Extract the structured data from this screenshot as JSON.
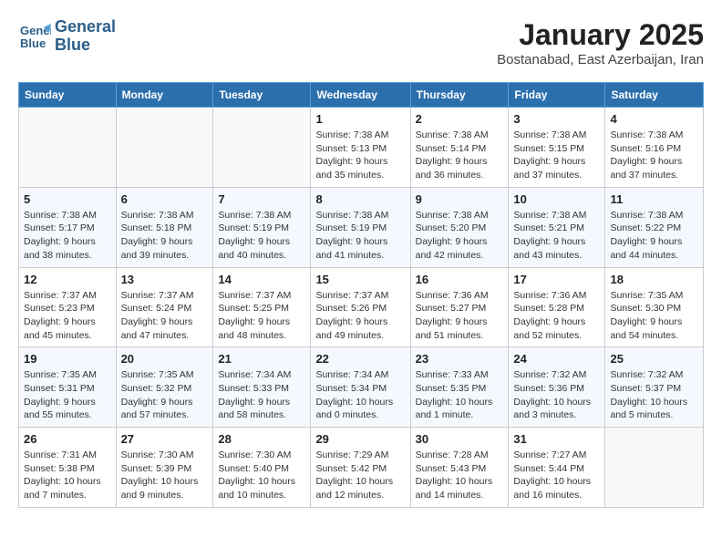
{
  "header": {
    "logo_line1": "General",
    "logo_line2": "Blue",
    "month": "January 2025",
    "location": "Bostanabad, East Azerbaijan, Iran"
  },
  "weekdays": [
    "Sunday",
    "Monday",
    "Tuesday",
    "Wednesday",
    "Thursday",
    "Friday",
    "Saturday"
  ],
  "weeks": [
    [
      {
        "day": "",
        "info": ""
      },
      {
        "day": "",
        "info": ""
      },
      {
        "day": "",
        "info": ""
      },
      {
        "day": "1",
        "info": "Sunrise: 7:38 AM\nSunset: 5:13 PM\nDaylight: 9 hours\nand 35 minutes."
      },
      {
        "day": "2",
        "info": "Sunrise: 7:38 AM\nSunset: 5:14 PM\nDaylight: 9 hours\nand 36 minutes."
      },
      {
        "day": "3",
        "info": "Sunrise: 7:38 AM\nSunset: 5:15 PM\nDaylight: 9 hours\nand 37 minutes."
      },
      {
        "day": "4",
        "info": "Sunrise: 7:38 AM\nSunset: 5:16 PM\nDaylight: 9 hours\nand 37 minutes."
      }
    ],
    [
      {
        "day": "5",
        "info": "Sunrise: 7:38 AM\nSunset: 5:17 PM\nDaylight: 9 hours\nand 38 minutes."
      },
      {
        "day": "6",
        "info": "Sunrise: 7:38 AM\nSunset: 5:18 PM\nDaylight: 9 hours\nand 39 minutes."
      },
      {
        "day": "7",
        "info": "Sunrise: 7:38 AM\nSunset: 5:19 PM\nDaylight: 9 hours\nand 40 minutes."
      },
      {
        "day": "8",
        "info": "Sunrise: 7:38 AM\nSunset: 5:19 PM\nDaylight: 9 hours\nand 41 minutes."
      },
      {
        "day": "9",
        "info": "Sunrise: 7:38 AM\nSunset: 5:20 PM\nDaylight: 9 hours\nand 42 minutes."
      },
      {
        "day": "10",
        "info": "Sunrise: 7:38 AM\nSunset: 5:21 PM\nDaylight: 9 hours\nand 43 minutes."
      },
      {
        "day": "11",
        "info": "Sunrise: 7:38 AM\nSunset: 5:22 PM\nDaylight: 9 hours\nand 44 minutes."
      }
    ],
    [
      {
        "day": "12",
        "info": "Sunrise: 7:37 AM\nSunset: 5:23 PM\nDaylight: 9 hours\nand 45 minutes."
      },
      {
        "day": "13",
        "info": "Sunrise: 7:37 AM\nSunset: 5:24 PM\nDaylight: 9 hours\nand 47 minutes."
      },
      {
        "day": "14",
        "info": "Sunrise: 7:37 AM\nSunset: 5:25 PM\nDaylight: 9 hours\nand 48 minutes."
      },
      {
        "day": "15",
        "info": "Sunrise: 7:37 AM\nSunset: 5:26 PM\nDaylight: 9 hours\nand 49 minutes."
      },
      {
        "day": "16",
        "info": "Sunrise: 7:36 AM\nSunset: 5:27 PM\nDaylight: 9 hours\nand 51 minutes."
      },
      {
        "day": "17",
        "info": "Sunrise: 7:36 AM\nSunset: 5:28 PM\nDaylight: 9 hours\nand 52 minutes."
      },
      {
        "day": "18",
        "info": "Sunrise: 7:35 AM\nSunset: 5:30 PM\nDaylight: 9 hours\nand 54 minutes."
      }
    ],
    [
      {
        "day": "19",
        "info": "Sunrise: 7:35 AM\nSunset: 5:31 PM\nDaylight: 9 hours\nand 55 minutes."
      },
      {
        "day": "20",
        "info": "Sunrise: 7:35 AM\nSunset: 5:32 PM\nDaylight: 9 hours\nand 57 minutes."
      },
      {
        "day": "21",
        "info": "Sunrise: 7:34 AM\nSunset: 5:33 PM\nDaylight: 9 hours\nand 58 minutes."
      },
      {
        "day": "22",
        "info": "Sunrise: 7:34 AM\nSunset: 5:34 PM\nDaylight: 10 hours\nand 0 minutes."
      },
      {
        "day": "23",
        "info": "Sunrise: 7:33 AM\nSunset: 5:35 PM\nDaylight: 10 hours\nand 1 minute."
      },
      {
        "day": "24",
        "info": "Sunrise: 7:32 AM\nSunset: 5:36 PM\nDaylight: 10 hours\nand 3 minutes."
      },
      {
        "day": "25",
        "info": "Sunrise: 7:32 AM\nSunset: 5:37 PM\nDaylight: 10 hours\nand 5 minutes."
      }
    ],
    [
      {
        "day": "26",
        "info": "Sunrise: 7:31 AM\nSunset: 5:38 PM\nDaylight: 10 hours\nand 7 minutes."
      },
      {
        "day": "27",
        "info": "Sunrise: 7:30 AM\nSunset: 5:39 PM\nDaylight: 10 hours\nand 9 minutes."
      },
      {
        "day": "28",
        "info": "Sunrise: 7:30 AM\nSunset: 5:40 PM\nDaylight: 10 hours\nand 10 minutes."
      },
      {
        "day": "29",
        "info": "Sunrise: 7:29 AM\nSunset: 5:42 PM\nDaylight: 10 hours\nand 12 minutes."
      },
      {
        "day": "30",
        "info": "Sunrise: 7:28 AM\nSunset: 5:43 PM\nDaylight: 10 hours\nand 14 minutes."
      },
      {
        "day": "31",
        "info": "Sunrise: 7:27 AM\nSunset: 5:44 PM\nDaylight: 10 hours\nand 16 minutes."
      },
      {
        "day": "",
        "info": ""
      }
    ]
  ]
}
